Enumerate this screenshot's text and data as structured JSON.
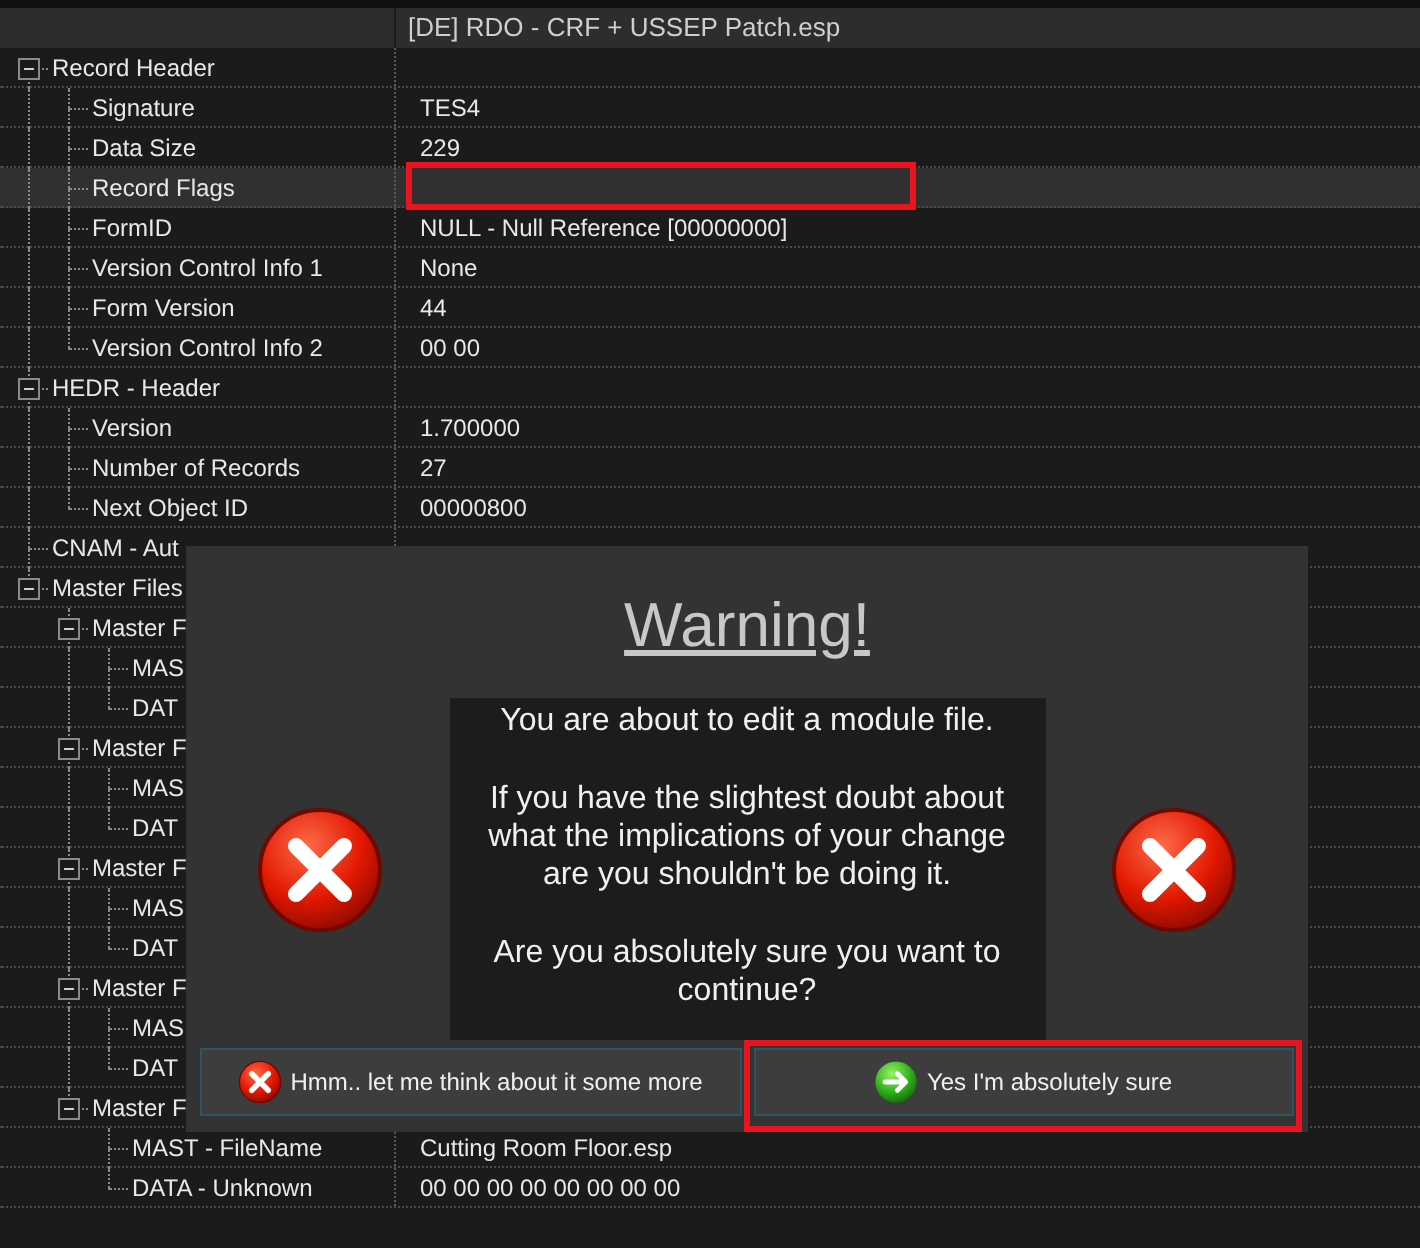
{
  "header": {
    "column_2": "[DE] RDO - CRF + USSEP Patch.esp"
  },
  "tree": [
    {
      "label": "Record Header",
      "expanded": true,
      "selected": false,
      "children": [
        {
          "label": "Signature",
          "value": "TES4",
          "selected": false
        },
        {
          "label": "Data Size",
          "value": "229",
          "selected": false
        },
        {
          "label": "Record Flags",
          "selected": true,
          "outlined": true
        },
        {
          "label": "FormID",
          "value": "NULL - Null Reference [00000000]",
          "selected": false
        },
        {
          "label": "Version Control Info 1",
          "value": "None",
          "selected": false
        },
        {
          "label": "Form Version",
          "value": "44",
          "selected": false
        },
        {
          "label": "Version Control Info 2",
          "value": "00 00",
          "selected": false
        }
      ]
    },
    {
      "label": "HEDR - Header",
      "expanded": true,
      "selected": false,
      "children": [
        {
          "label": "Version",
          "value": "1.700000",
          "selected": false
        },
        {
          "label": "Number of Records",
          "value": "27",
          "selected": false
        },
        {
          "label": "Next Object ID",
          "value": "00000800",
          "selected": false
        }
      ]
    },
    {
      "label": "CNAM - Aut",
      "selected": false
    },
    {
      "label": "Master Files",
      "expanded": true,
      "selected": false,
      "children": [
        {
          "label": "Master F",
          "expanded": true,
          "selected": false,
          "children": [
            {
              "label": "MAS",
              "selected": false
            },
            {
              "label": "DAT",
              "selected": false
            }
          ]
        },
        {
          "label": "Master F",
          "expanded": true,
          "selected": false,
          "children": [
            {
              "label": "MAS",
              "selected": false
            },
            {
              "label": "DAT",
              "selected": false
            }
          ]
        },
        {
          "label": "Master F",
          "expanded": true,
          "selected": false,
          "children": [
            {
              "label": "MAS",
              "selected": false
            },
            {
              "label": "DAT",
              "selected": false
            }
          ]
        },
        {
          "label": "Master F",
          "expanded": true,
          "selected": false,
          "children": [
            {
              "label": "MAS",
              "selected": false
            },
            {
              "label": "DAT",
              "selected": false
            }
          ]
        },
        {
          "label": "Master F",
          "expanded": true,
          "selected": false,
          "children": [
            {
              "label": "MAST - FileName",
              "value": "Cutting Room Floor.esp",
              "selected": false
            },
            {
              "label": "DATA - Unknown",
              "value": "00 00 00 00 00 00 00 00",
              "selected": false
            }
          ]
        }
      ]
    }
  ],
  "dialog": {
    "title": "Warning!",
    "message": [
      "You are about to edit a module file.",
      "If you have the slightest doubt about what the implications of your change are you shouldn't be doing it.",
      "Are you absolutely sure you want to continue?"
    ],
    "buttons": [
      {
        "kind": "cancel",
        "label": "Hmm.. let me think about it some more",
        "outlined": false
      },
      {
        "kind": "confirm",
        "label": "Yes I'm absolutely sure",
        "outlined": true
      }
    ]
  }
}
